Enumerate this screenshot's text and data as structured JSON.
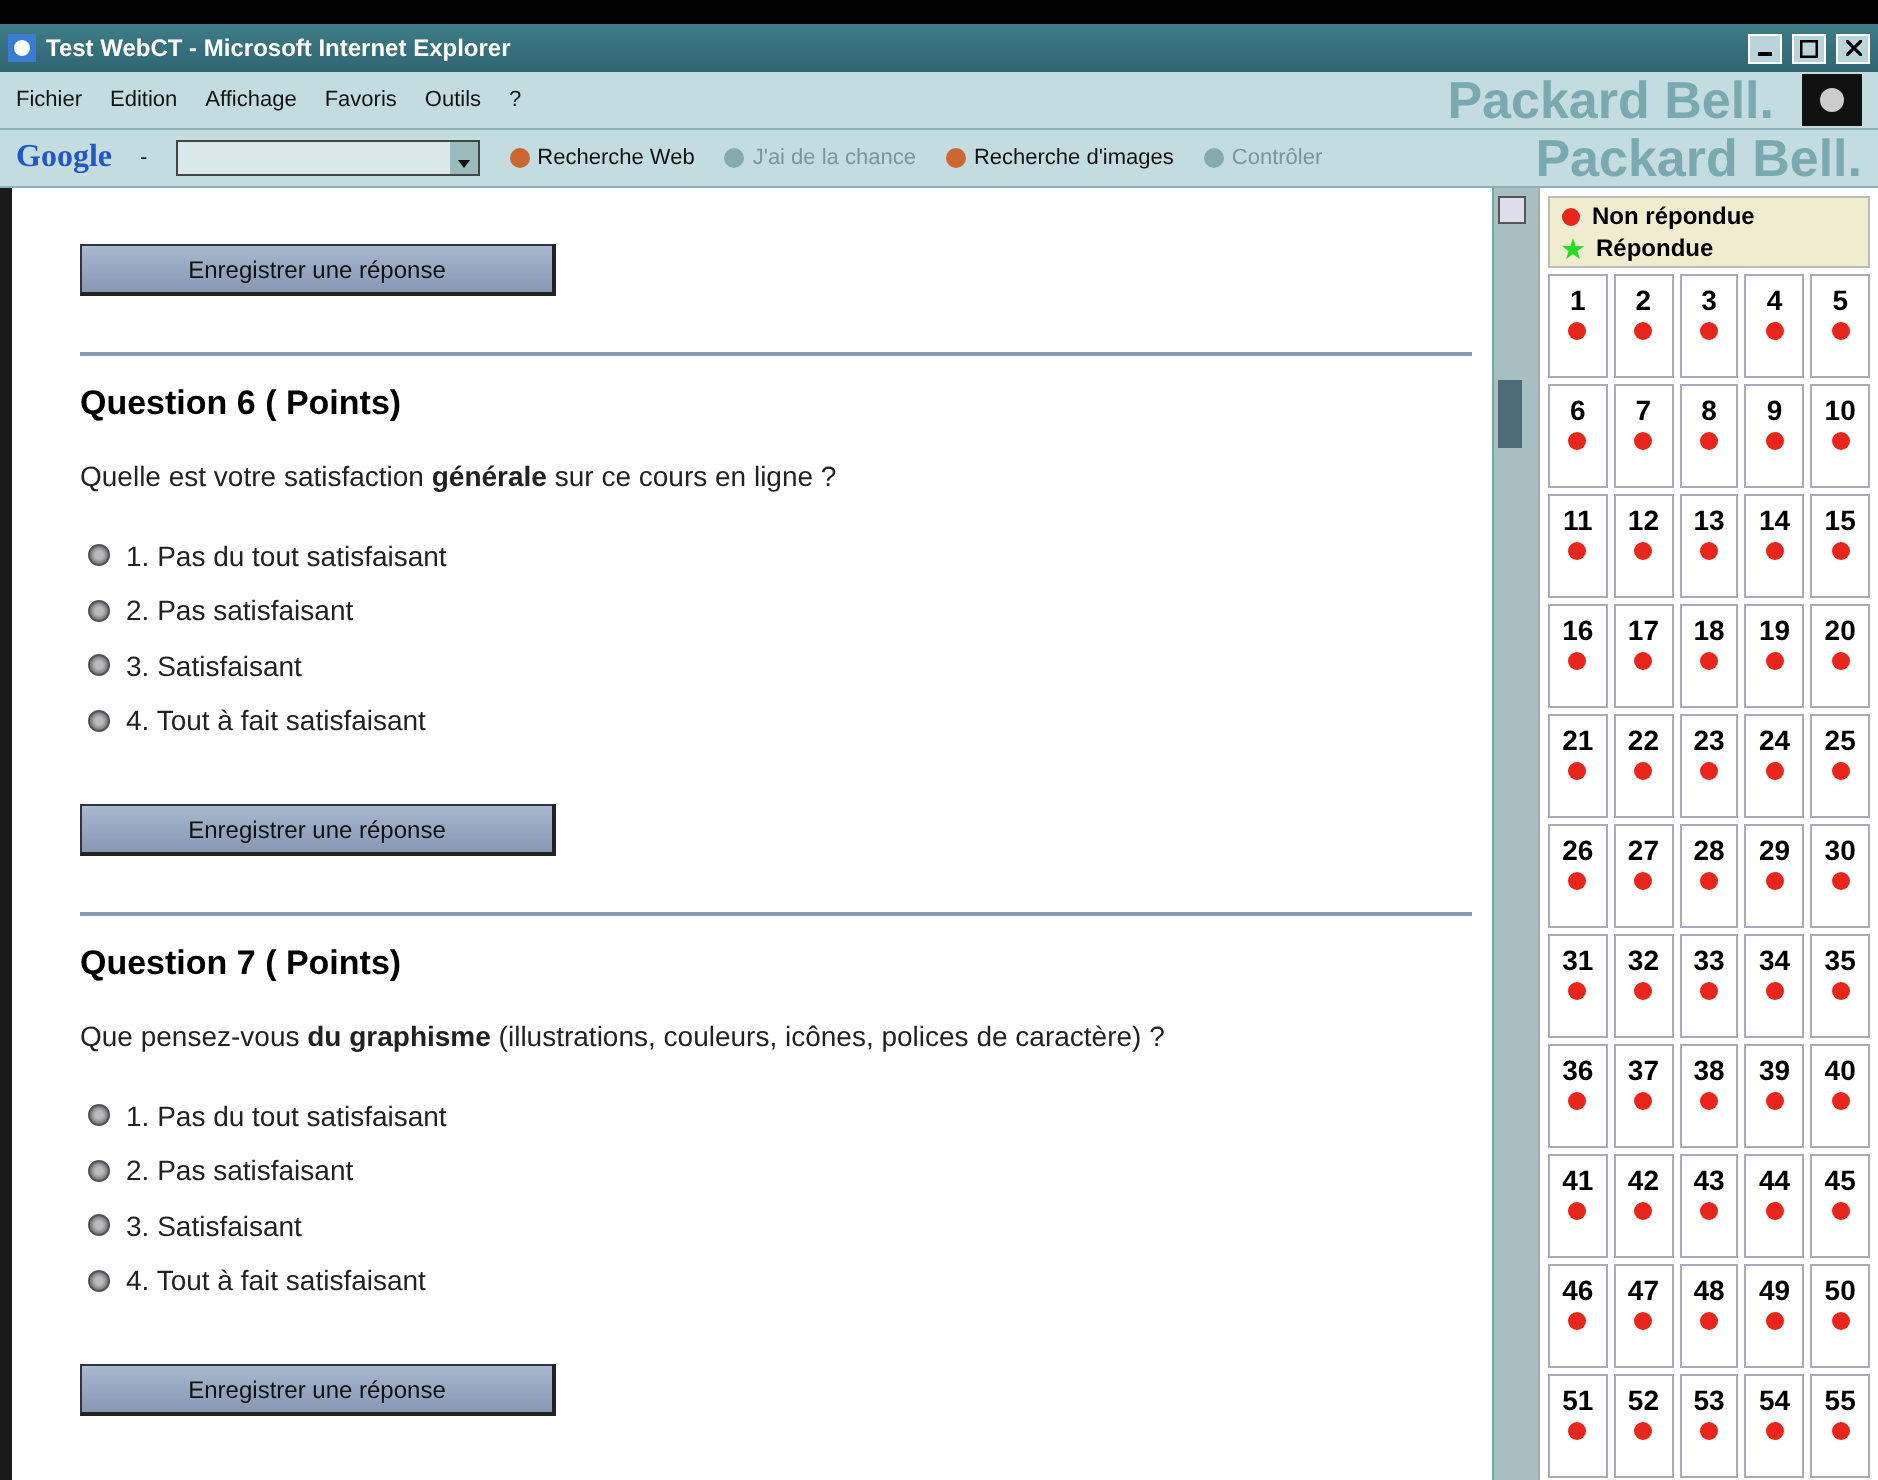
{
  "window": {
    "title": "Test WebCT - Microsoft Internet Explorer"
  },
  "menu": [
    "Fichier",
    "Edition",
    "Affichage",
    "Favoris",
    "Outils",
    "?"
  ],
  "brand": "Packard Bell.",
  "google_toolbar": {
    "logo": "Google",
    "dropdown": "-",
    "buttons": [
      {
        "label": "Recherche Web",
        "disabled": false
      },
      {
        "label": "J'ai de la chance",
        "disabled": true
      },
      {
        "label": "Recherche d'images",
        "disabled": false
      },
      {
        "label": "Contrôler",
        "disabled": true
      }
    ],
    "brand": "Packard Bell."
  },
  "top_button": "Enregistrer une réponse",
  "questions": [
    {
      "title": "Question 6  ( Points)",
      "text": "Quelle est votre satisfaction **générale** sur ce cours en ligne ?",
      "options": [
        {
          "label": "1. Pas du tout satisfaisant",
          "selected": false
        },
        {
          "label": "2. Pas satisfaisant",
          "selected": false
        },
        {
          "label": "3. Satisfaisant",
          "selected": false
        },
        {
          "label": "4. Tout à fait satisfaisant",
          "selected": false
        }
      ],
      "button": "Enregistrer une réponse"
    },
    {
      "title": "Question 7  ( Points)",
      "text": "Que pensez-vous **du graphisme** (illustrations, couleurs, icônes, polices de caractère) ?",
      "options": [
        {
          "label": "1. Pas du tout satisfaisant",
          "selected": false
        },
        {
          "label": "2. Pas satisfaisant",
          "selected": false
        },
        {
          "label": "3. Satisfaisant",
          "selected": false
        },
        {
          "label": "4. Tout à fait satisfaisant",
          "selected": false
        }
      ],
      "button": "Enregistrer une réponse"
    }
  ],
  "legend": [
    {
      "kind": "unanswered",
      "label": "Non répondue"
    },
    {
      "kind": "answered",
      "label": "Répondue"
    }
  ],
  "grid": [
    {
      "number": "1",
      "answered": false
    },
    {
      "number": "2",
      "answered": false
    },
    {
      "number": "3",
      "answered": false
    },
    {
      "number": "4",
      "answered": false
    },
    {
      "number": "5",
      "answered": false
    },
    {
      "number": "6",
      "answered": false
    },
    {
      "number": "7",
      "answered": false
    },
    {
      "number": "8",
      "answered": false
    },
    {
      "number": "9",
      "answered": false
    },
    {
      "number": "10",
      "answered": false
    },
    {
      "number": "11",
      "answered": false
    },
    {
      "number": "12",
      "answered": false
    },
    {
      "number": "13",
      "answered": false
    },
    {
      "number": "14",
      "answered": false
    },
    {
      "number": "15",
      "answered": false
    },
    {
      "number": "16",
      "answered": false
    },
    {
      "number": "17",
      "answered": false
    },
    {
      "number": "18",
      "answered": false
    },
    {
      "number": "19",
      "answered": false
    },
    {
      "number": "20",
      "answered": false
    },
    {
      "number": "21",
      "answered": false
    },
    {
      "number": "22",
      "answered": false
    },
    {
      "number": "23",
      "answered": false
    },
    {
      "number": "24",
      "answered": false
    },
    {
      "number": "25",
      "answered": false
    },
    {
      "number": "26",
      "answered": false
    },
    {
      "number": "27",
      "answered": false
    },
    {
      "number": "28",
      "answered": false
    },
    {
      "number": "29",
      "answered": false
    },
    {
      "number": "30",
      "answered": false
    },
    {
      "number": "31",
      "answered": false
    },
    {
      "number": "32",
      "answered": false
    },
    {
      "number": "33",
      "answered": false
    },
    {
      "number": "34",
      "answered": false
    },
    {
      "number": "35",
      "answered": false
    },
    {
      "number": "36",
      "answered": false
    },
    {
      "number": "37",
      "answered": false
    },
    {
      "number": "38",
      "answered": false
    },
    {
      "number": "39",
      "answered": false
    },
    {
      "number": "40",
      "answered": false
    },
    {
      "number": "41",
      "answered": false
    },
    {
      "number": "42",
      "answered": false
    },
    {
      "number": "43",
      "answered": false
    },
    {
      "number": "44",
      "answered": false
    },
    {
      "number": "45",
      "answered": false
    },
    {
      "number": "46",
      "answered": false
    },
    {
      "number": "47",
      "answered": false
    },
    {
      "number": "48",
      "answered": false
    },
    {
      "number": "49",
      "answered": false
    },
    {
      "number": "50",
      "answered": false
    },
    {
      "number": "51",
      "answered": false
    },
    {
      "number": "52",
      "answered": false
    },
    {
      "number": "53",
      "answered": false
    },
    {
      "number": "54",
      "answered": false
    },
    {
      "number": "55",
      "answered": false
    }
  ]
}
